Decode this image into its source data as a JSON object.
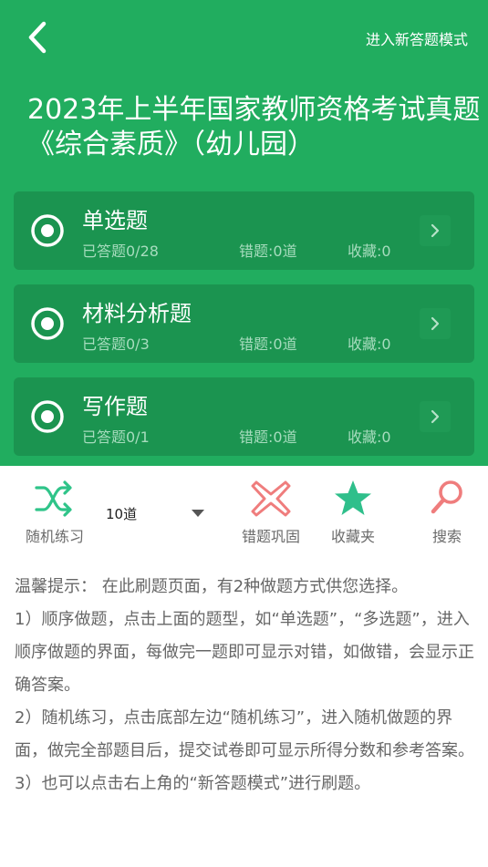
{
  "header": {
    "new_mode": "进入新答题模式",
    "title": "2023年上半年国家教师资格考试真题《综合素质》（幼儿园）",
    "bg_color": "#21ad5f",
    "card_color": "#1b9450"
  },
  "sections": [
    {
      "name": "单选题",
      "answered": "已答题0/28",
      "wrong": "错题:0道",
      "fav": "收藏:0"
    },
    {
      "name": "材料分析题",
      "answered": "已答题0/3",
      "wrong": "错题:0道",
      "fav": "收藏:0"
    },
    {
      "name": "写作题",
      "answered": "已答题0/1",
      "wrong": "错题:0道",
      "fav": "收藏:0"
    }
  ],
  "toolbar": {
    "random_label": "随机练习",
    "count_value": "10道",
    "wrong_label": "错题巩固",
    "fav_label": "收藏夹",
    "search_label": "搜索",
    "icons": {
      "random": "shuffle-icon",
      "wrong": "cross-icon",
      "fav": "star-icon",
      "search": "search-icon"
    },
    "colors": {
      "shuffle": "#2fc489",
      "cross": "#ef7d7d",
      "star": "#2fbf8b",
      "search": "#ef7d7d"
    }
  },
  "tips": {
    "intro": "温馨提示： 在此刷题页面，有2种做题方式供您选择。",
    "p1": " 1）顺序做题，点击上面的题型，如“单选题”，“多选题”，进入顺序做题的界面，每做完一题即可显示对错，如做错，会显示正确答案。",
    "p2": " 2）随机练习，点击底部左边“随机练习”，进入随机做题的界面，做完全部题目后，提交试卷即可显示所得分数和参考答案。",
    "p3": " 3）也可以点击右上角的“新答题模式”进行刷题。"
  }
}
